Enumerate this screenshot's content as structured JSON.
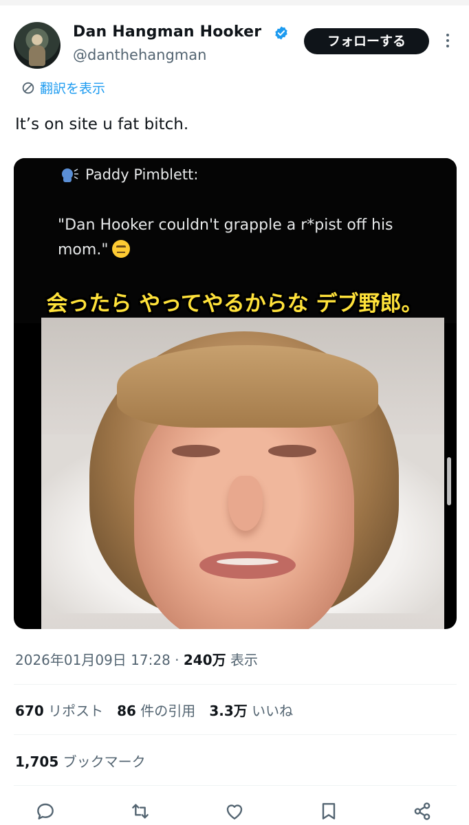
{
  "header": {
    "display_name": "Dan Hangman Hooker",
    "handle": "@danthehangman",
    "follow_label": "フォローする",
    "translate_label": "翻訳を表示"
  },
  "tweet": {
    "text": "It’s on site u fat bitch."
  },
  "media": {
    "quote_author": "Paddy Pimblett:",
    "quote_text": "\"Dan Hooker couldn't grapple a r*pist off his mom.\"",
    "caption": "会ったら やってやるからな デブ野郎。",
    "caption_color": "#ffe23a"
  },
  "meta": {
    "date": "2026年01月09日 17:28",
    "separator": " · ",
    "views_count": "240万",
    "views_label": " 表示"
  },
  "stats": {
    "reposts_count": "670",
    "reposts_label": " リポスト",
    "quotes_count": "86",
    "quotes_label": " 件の引用",
    "likes_count": "3.3万",
    "likes_label": " いいね",
    "bookmarks_count": "1,705",
    "bookmarks_label": " ブックマーク"
  },
  "actions": [
    "reply-icon",
    "repost-icon",
    "like-icon",
    "bookmark-icon",
    "share-icon"
  ],
  "colors": {
    "accent": "#1d9bf0",
    "text": "#0f1419",
    "secondary": "#536471"
  }
}
